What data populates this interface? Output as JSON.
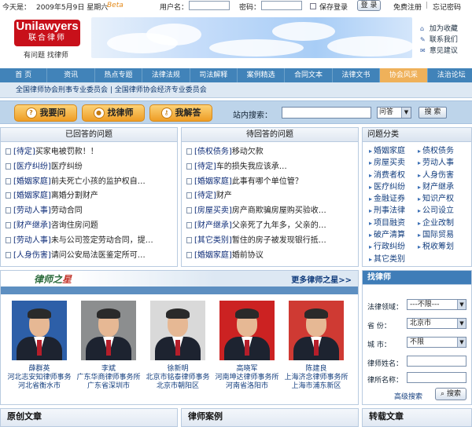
{
  "topbar": {
    "date_label": "今天是：",
    "date": "2009年5月9日 星期六",
    "beta": "Beta",
    "username_label": "用户名：",
    "password_label": "密码：",
    "remember_label": "保存登录",
    "login_btn": "登 录",
    "register": "免费注册",
    "forgot": "忘记密码"
  },
  "header": {
    "logo_en": "Unilawyers",
    "logo_cn": "联合律师",
    "slogan": "有问题  找律师",
    "quick_links": [
      {
        "icon": "home-icon",
        "label": "加为收藏"
      },
      {
        "icon": "contact-icon",
        "label": "联系我们"
      },
      {
        "icon": "feedback-icon",
        "label": "意见建议"
      }
    ]
  },
  "nav": {
    "items": [
      "首 页",
      "资讯",
      "热点专题",
      "法律法规",
      "司法解释",
      "案例精选",
      "合同文本",
      "法律文书",
      "协会风采",
      "法治论坛"
    ],
    "active_index": 8
  },
  "subnav": {
    "links": [
      "全国律师协会刑事专业委员会",
      "全国律师协会经济专业委员会"
    ]
  },
  "actions": {
    "ask": "我要问",
    "find": "找律师",
    "answer": "我解答",
    "search_label": "站内搜索：",
    "search_type": "问答",
    "search_btn": "搜 索"
  },
  "answered": {
    "title": "已回答的问题",
    "items": [
      {
        "tag": "[待定]",
        "text": "买家电被罚款！！"
      },
      {
        "tag": "[医疗纠纷]",
        "text": "医疗纠纷"
      },
      {
        "tag": "[婚姻家庭]",
        "text": "前夫死亡小孩的监护权自…"
      },
      {
        "tag": "[婚姻家庭]",
        "text": "离婚分割财产"
      },
      {
        "tag": "[劳动人事]",
        "text": "劳动合同"
      },
      {
        "tag": "[财产继承]",
        "text": "咨询住房问题"
      },
      {
        "tag": "[劳动人事]",
        "text": "未与公司签定劳动合同，提…"
      },
      {
        "tag": "[人身伤害]",
        "text": "请问公安局法医鉴定所可…"
      }
    ]
  },
  "pending": {
    "title": "待回答的问题",
    "items": [
      {
        "tag": "[债权债务]",
        "text": "移动欠款"
      },
      {
        "tag": "[待定]",
        "text": "车的损失我应该承…"
      },
      {
        "tag": "[婚姻家庭]",
        "text": "此事有哪个单位管？"
      },
      {
        "tag": "[待定]",
        "text": "财产"
      },
      {
        "tag": "[房屋买卖]",
        "text": "房产商欺骗房屋购买验收…"
      },
      {
        "tag": "[财产继承]",
        "text": "父亲死了九年多，父亲的…"
      },
      {
        "tag": "[其它类别]",
        "text": "暂住的房子被发现银行抵…"
      },
      {
        "tag": "[婚姻家庭]",
        "text": "婚前协议"
      }
    ]
  },
  "categories": {
    "title": "问题分类",
    "items": [
      "婚姻家庭",
      "债权债务",
      "房屋买卖",
      "劳动人事",
      "消费者权",
      "人身伤害",
      "医疗纠纷",
      "财产继承",
      "金融证券",
      "知识产权",
      "刑事法律",
      "公司设立",
      "项目融资",
      "企业改制",
      "破产清算",
      "国际贸易",
      "行政纠纷",
      "税收筹划",
      "其它类别"
    ]
  },
  "stars": {
    "title_a": "律师之",
    "title_b": "星",
    "more": "更多律师之星>>",
    "lawyers": [
      {
        "name": "薛群英",
        "firm": "河北志安知律师事务",
        "city": "河北省衡水市",
        "bg": "#2d5fa8"
      },
      {
        "name": "李斌",
        "firm": "广东华商律师事务所",
        "city": "广东省深圳市",
        "bg": "#8c8e8f"
      },
      {
        "name": "徐新明",
        "firm": "北京市铭泰律师事务",
        "city": "北京市朝阳区",
        "bg": "#d9d9d9"
      },
      {
        "name": "高晓军",
        "firm": "河南坤达律师事务所",
        "city": "河南省洛阳市",
        "bg": "#cc2222"
      },
      {
        "name": "陈建良",
        "firm": "上海济念律师事务所",
        "city": "上海市浦东新区",
        "bg": "#cf3a33"
      }
    ]
  },
  "find": {
    "title": "找律师",
    "fields": [
      {
        "label": "法律领域：",
        "value": "---不限---",
        "type": "select"
      },
      {
        "label": "省      份：",
        "value": "北京市",
        "type": "select"
      },
      {
        "label": "城      市：",
        "value": "不限",
        "type": "select"
      },
      {
        "label": "律师姓名：",
        "value": "",
        "type": "input"
      },
      {
        "label": "律所名称：",
        "value": "",
        "type": "input"
      }
    ],
    "adv": "高级搜索",
    "btn": "搜索"
  },
  "bottom": {
    "original": "原创文章",
    "cases": "律师案例",
    "reprint": "转载文章"
  },
  "colors": {
    "nav": "#4183b9",
    "nav_active": "#efb15a",
    "logo": "#c8101a",
    "link": "#123d7d"
  }
}
